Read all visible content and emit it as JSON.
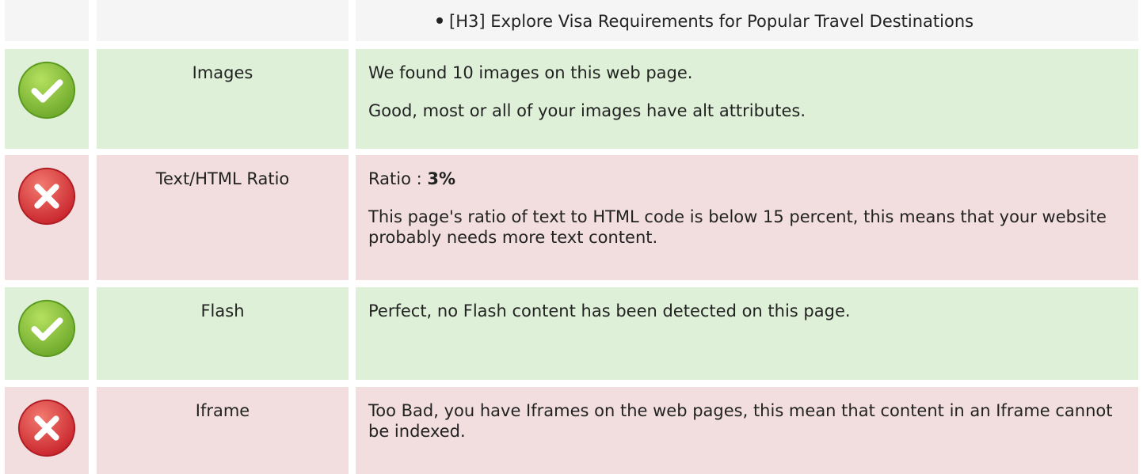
{
  "top_row": {
    "heading_item": "[H3] Explore Visa Requirements for Popular Travel Destinations"
  },
  "rows": [
    {
      "status": "pass",
      "status_icon": "check-circle-icon",
      "label": "Images",
      "lines": [
        "We found 10 images on this web page.",
        "Good, most or all of your images have alt attributes."
      ]
    },
    {
      "status": "fail",
      "status_icon": "cross-circle-icon",
      "label": "Text/HTML Ratio",
      "ratio_prefix": "Ratio : ",
      "ratio_value": "3%",
      "lines": [
        "This page's ratio of text to HTML code is below 15 percent, this means that your website probably needs more text content."
      ]
    },
    {
      "status": "pass",
      "status_icon": "check-circle-icon",
      "label": "Flash",
      "lines": [
        "Perfect, no Flash content has been detected on this page."
      ]
    },
    {
      "status": "fail",
      "status_icon": "cross-circle-icon",
      "label": "Iframe",
      "lines": [
        "Too Bad, you have Iframes on the web pages, this mean that content in an Iframe cannot be indexed."
      ]
    }
  ],
  "colors": {
    "pass_bg": "#dff0d8",
    "fail_bg": "#f2dede",
    "neutral_bg": "#f5f5f5",
    "pass_icon": "#8cc63f",
    "fail_icon": "#e0393e"
  }
}
